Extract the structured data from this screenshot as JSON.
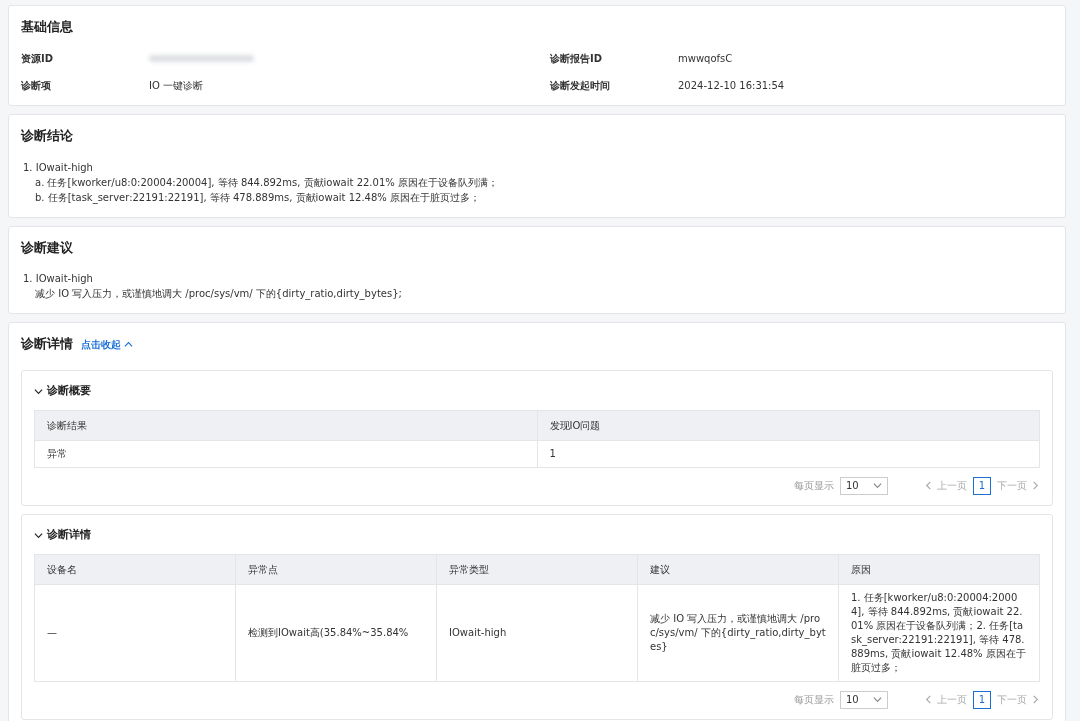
{
  "basic_info": {
    "title": "基础信息",
    "fields": [
      {
        "label": "资源ID",
        "redacted": true
      },
      {
        "label": "诊断报告ID",
        "value": "mwwqofsC",
        "redacted": false
      },
      {
        "label": "诊断项",
        "value": "IO 一键诊断",
        "redacted": false
      },
      {
        "label": "诊断发起时间",
        "value": "2024-12-10 16:31:54",
        "redacted": false
      }
    ]
  },
  "conclusion": {
    "title": "诊断结论",
    "items": [
      {
        "label": "1. IOwait-high",
        "children": [
          {
            "label": "a. 任务[kworker/u8:0:20004:20004], 等待 844.892ms, 贡献iowait 22.01% 原因在于设备队列满；"
          },
          {
            "label": "b. 任务[task_server:22191:22191], 等待 478.889ms, 贡献iowait 12.48% 原因在于脏页过多；"
          }
        ]
      }
    ]
  },
  "suggestion": {
    "title": "诊断建议",
    "items": [
      {
        "label": "1. IOwait-high",
        "children": [
          {
            "label": "减少 IO 写入压力，或谨慎地调大 /proc/sys/vm/ 下的{dirty_ratio,dirty_bytes};"
          }
        ]
      }
    ]
  },
  "details": {
    "title": "诊断详情",
    "toggle": "点击收起",
    "expanded": true,
    "panels": [
      {
        "title": "诊断概要",
        "expanded": true,
        "columns": [
          "诊断结果",
          "发现IO问题"
        ],
        "rows": [
          [
            "异常",
            "1"
          ]
        ],
        "pagination": {
          "page_size_label": "每页显示",
          "page_size": "10",
          "prev": "上一页",
          "next": "下一页",
          "prev_disabled": true,
          "next_disabled": true,
          "pages": [
            {
              "label": "1",
              "selected": true
            }
          ]
        }
      },
      {
        "title": "诊断详情",
        "expanded": true,
        "columns": [
          "设备名",
          "异常点",
          "异常类型",
          "建议",
          "原因"
        ],
        "rows": [
          [
            "—",
            "检测到IOwait高(35.84%~35.84%",
            "IOwait-high",
            "减少 IO 写入压力，或谨慎地调大 /proc/sys/vm/ 下的{dirty_ratio,dirty_bytes}",
            "1. 任务[kworker/u8:0:20004:20004], 等待 844.892ms, 贡献iowait 22.01% 原因在于设备队列满；2. 任务[task_server:22191:22191], 等待 478.889ms, 贡献iowait 12.48% 原因在于脏页过多；"
          ]
        ],
        "pagination": {
          "page_size_label": "每页显示",
          "page_size": "10",
          "prev": "上一页",
          "next": "下一页",
          "prev_disabled": true,
          "next_disabled": true,
          "pages": [
            {
              "label": "1",
              "selected": true
            }
          ]
        }
      }
    ]
  }
}
